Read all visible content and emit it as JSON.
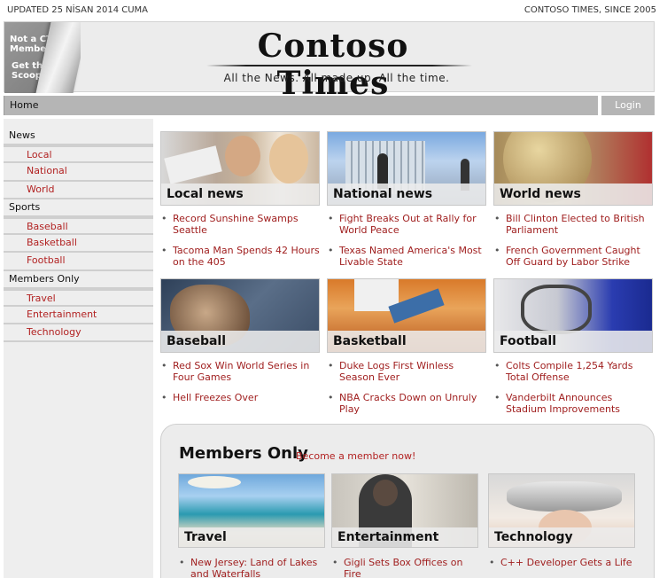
{
  "topbar": {
    "updated": "UPDATED 25 NİSAN 2014 CUMA",
    "since": "CONTOSO TIMES, SINCE 2005"
  },
  "masthead": {
    "peel_line1": "Not a CT Member?",
    "peel_line2": "Get the Scoop!",
    "logo": "Contoso Times",
    "tagline": "All the News. All made up. All the time."
  },
  "nav": {
    "home": "Home",
    "login": "Login"
  },
  "sidebar": {
    "sections": [
      {
        "label": "News",
        "items": [
          "Local",
          "National",
          "World"
        ]
      },
      {
        "label": "Sports",
        "items": [
          "Baseball",
          "Basketball",
          "Football"
        ]
      },
      {
        "label": "Members Only",
        "items": [
          "Travel",
          "Entertainment",
          "Technology"
        ]
      }
    ]
  },
  "cards": [
    {
      "title": "Local news",
      "headlines": [
        "Record Sunshine Swamps Seattle",
        "Tacoma Man Spends 42 Hours on the 405"
      ]
    },
    {
      "title": "National news",
      "headlines": [
        "Fight Breaks Out at Rally for World Peace",
        "Texas Named America's Most Livable State"
      ]
    },
    {
      "title": "World news",
      "headlines": [
        "Bill Clinton Elected to British Parliament",
        "French Government Caught Off Guard by Labor Strike"
      ]
    },
    {
      "title": "Baseball",
      "headlines": [
        "Red Sox Win World Series in Four Games",
        "Hell Freezes Over"
      ]
    },
    {
      "title": "Basketball",
      "headlines": [
        "Duke Logs First Winless Season Ever",
        "NBA Cracks Down on Unruly Play"
      ]
    },
    {
      "title": "Football",
      "headlines": [
        "Colts Compile 1,254 Yards Total Offense",
        "Vanderbilt Announces Stadium Improvements"
      ]
    }
  ],
  "members": {
    "title": "Members Only",
    "link": "Become a member now!",
    "cards": [
      {
        "title": "Travel",
        "headlines": [
          "New Jersey: Land of Lakes and Waterfalls"
        ]
      },
      {
        "title": "Entertainment",
        "headlines": [
          "Gigli Sets Box Offices on Fire"
        ]
      },
      {
        "title": "Technology",
        "headlines": [
          "C++ Developer Gets a Life"
        ]
      }
    ]
  },
  "colors": {
    "accent": "#b22222",
    "navbar": "#b5b5b5",
    "sidebar": "#eeeeee"
  }
}
